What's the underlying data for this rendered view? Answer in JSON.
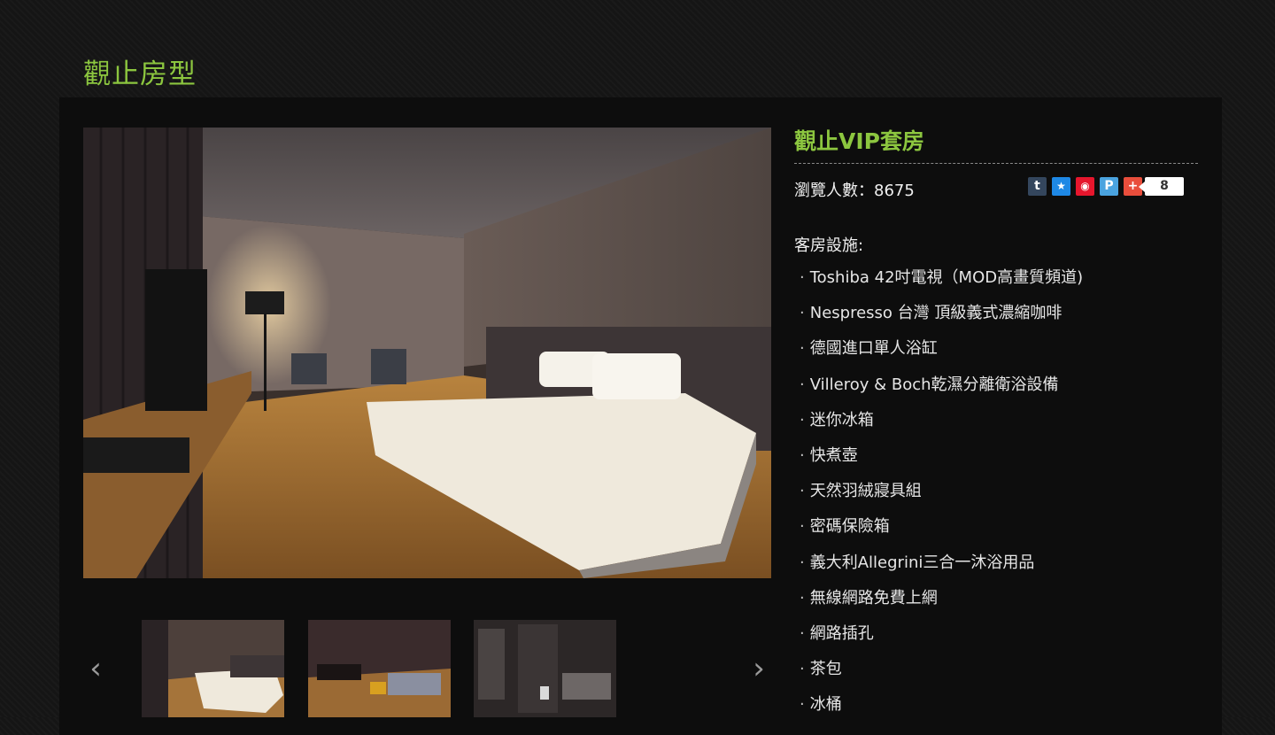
{
  "page": {
    "title": "觀止房型"
  },
  "room": {
    "name": "觀止VIP套房",
    "views_text": "瀏覽人數：8675",
    "share": {
      "icons": [
        "tumblr-icon",
        "favorite-star-icon",
        "weibo-icon",
        "plurk-icon",
        "plus-share-icon"
      ],
      "icon_glyphs": [
        "t",
        "★",
        "◉",
        "P",
        "+"
      ],
      "count": "8"
    },
    "facilities_heading": "客房設施:",
    "facilities": [
      "Toshiba 42吋電視（MOD高畫質頻道)",
      "Nespresso 台灣 頂級義式濃縮咖啡",
      "德國進口單人浴缸",
      "Villeroy & Boch乾濕分離衛浴設備",
      "迷你冰箱",
      "快煮壺",
      "天然羽絨寢具組",
      "密碼保險箱",
      "義大利Allegrini三合一沐浴用品",
      "無線網路免費上網",
      "網路插孔",
      "茶包",
      "冰桶"
    ],
    "bullet": "·"
  },
  "gallery": {
    "prev": "‹",
    "next": "›"
  },
  "colors": {
    "accent": "#8cc63f",
    "background": "#151515",
    "panel": "#0d0d0d",
    "tumblr": "#34465d",
    "star": "#1e88e5",
    "weibo": "#e6162d",
    "plurk": "#4aa3df",
    "plus": "#e94e3c"
  }
}
